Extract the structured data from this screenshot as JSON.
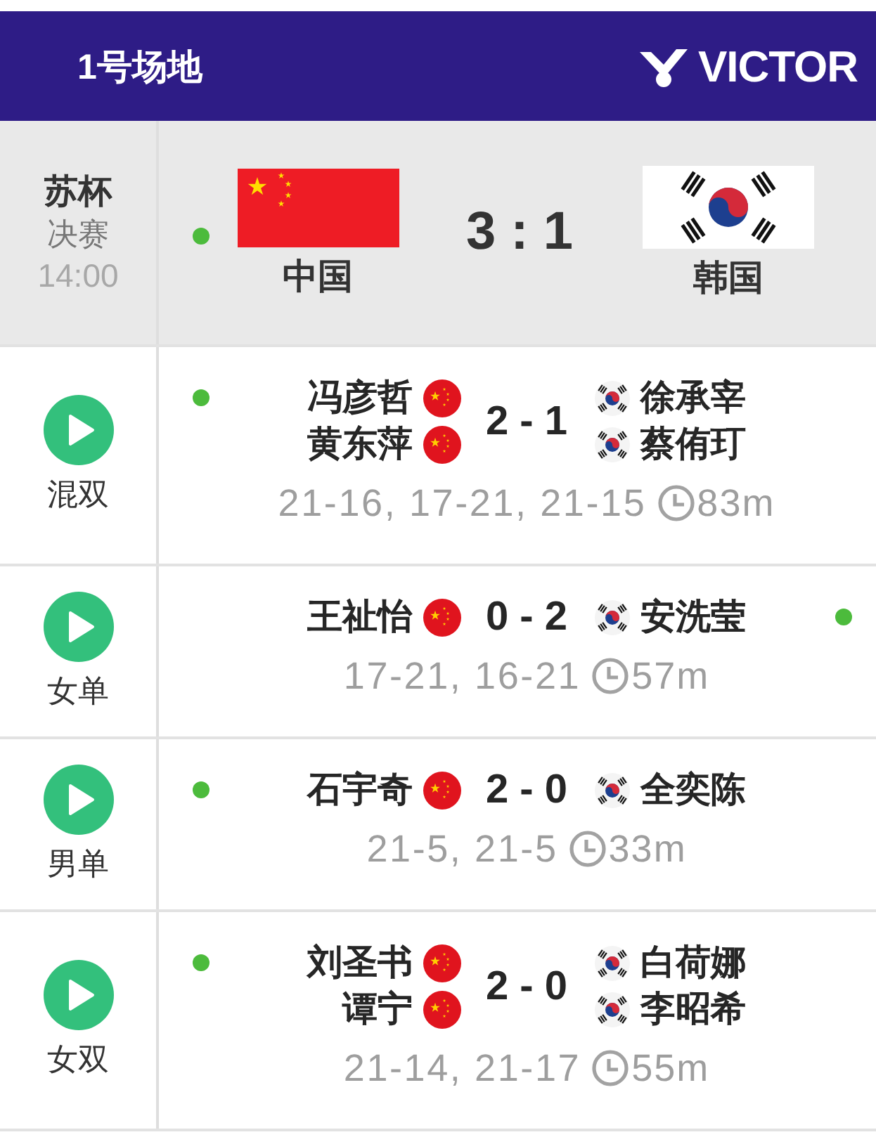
{
  "header": {
    "court": "1号场地",
    "brand": "VICTOR"
  },
  "tie": {
    "event": "苏杯",
    "stage": "决赛",
    "time": "14:00",
    "teams": [
      {
        "name": "中国",
        "dot": true
      },
      {
        "name": "韩国",
        "dot": false
      }
    ],
    "score": "3 : 1"
  },
  "matches": [
    {
      "category": "混双",
      "home": [
        "冯彦哲",
        "黄东萍"
      ],
      "away": [
        "徐承宰",
        "蔡侑玎"
      ],
      "score": "2 - 1",
      "games": "21-16, 17-21, 21-15",
      "duration": "83m",
      "home_dot": true,
      "away_dot": false
    },
    {
      "category": "女单",
      "home": [
        "王祉怡"
      ],
      "away": [
        "安洗莹"
      ],
      "score": "0 - 2",
      "games": "17-21, 16-21",
      "duration": "57m",
      "home_dot": false,
      "away_dot": true
    },
    {
      "category": "男单",
      "home": [
        "石宇奇"
      ],
      "away": [
        "全奕陈"
      ],
      "score": "2 - 0",
      "games": "21-5, 21-5",
      "duration": "33m",
      "home_dot": true,
      "away_dot": false
    },
    {
      "category": "女双",
      "home": [
        "刘圣书",
        "谭宁"
      ],
      "away": [
        "白荷娜",
        "李昭希"
      ],
      "score": "2 - 0",
      "games": "21-14, 21-17",
      "duration": "55m",
      "home_dot": true,
      "away_dot": false
    }
  ]
}
